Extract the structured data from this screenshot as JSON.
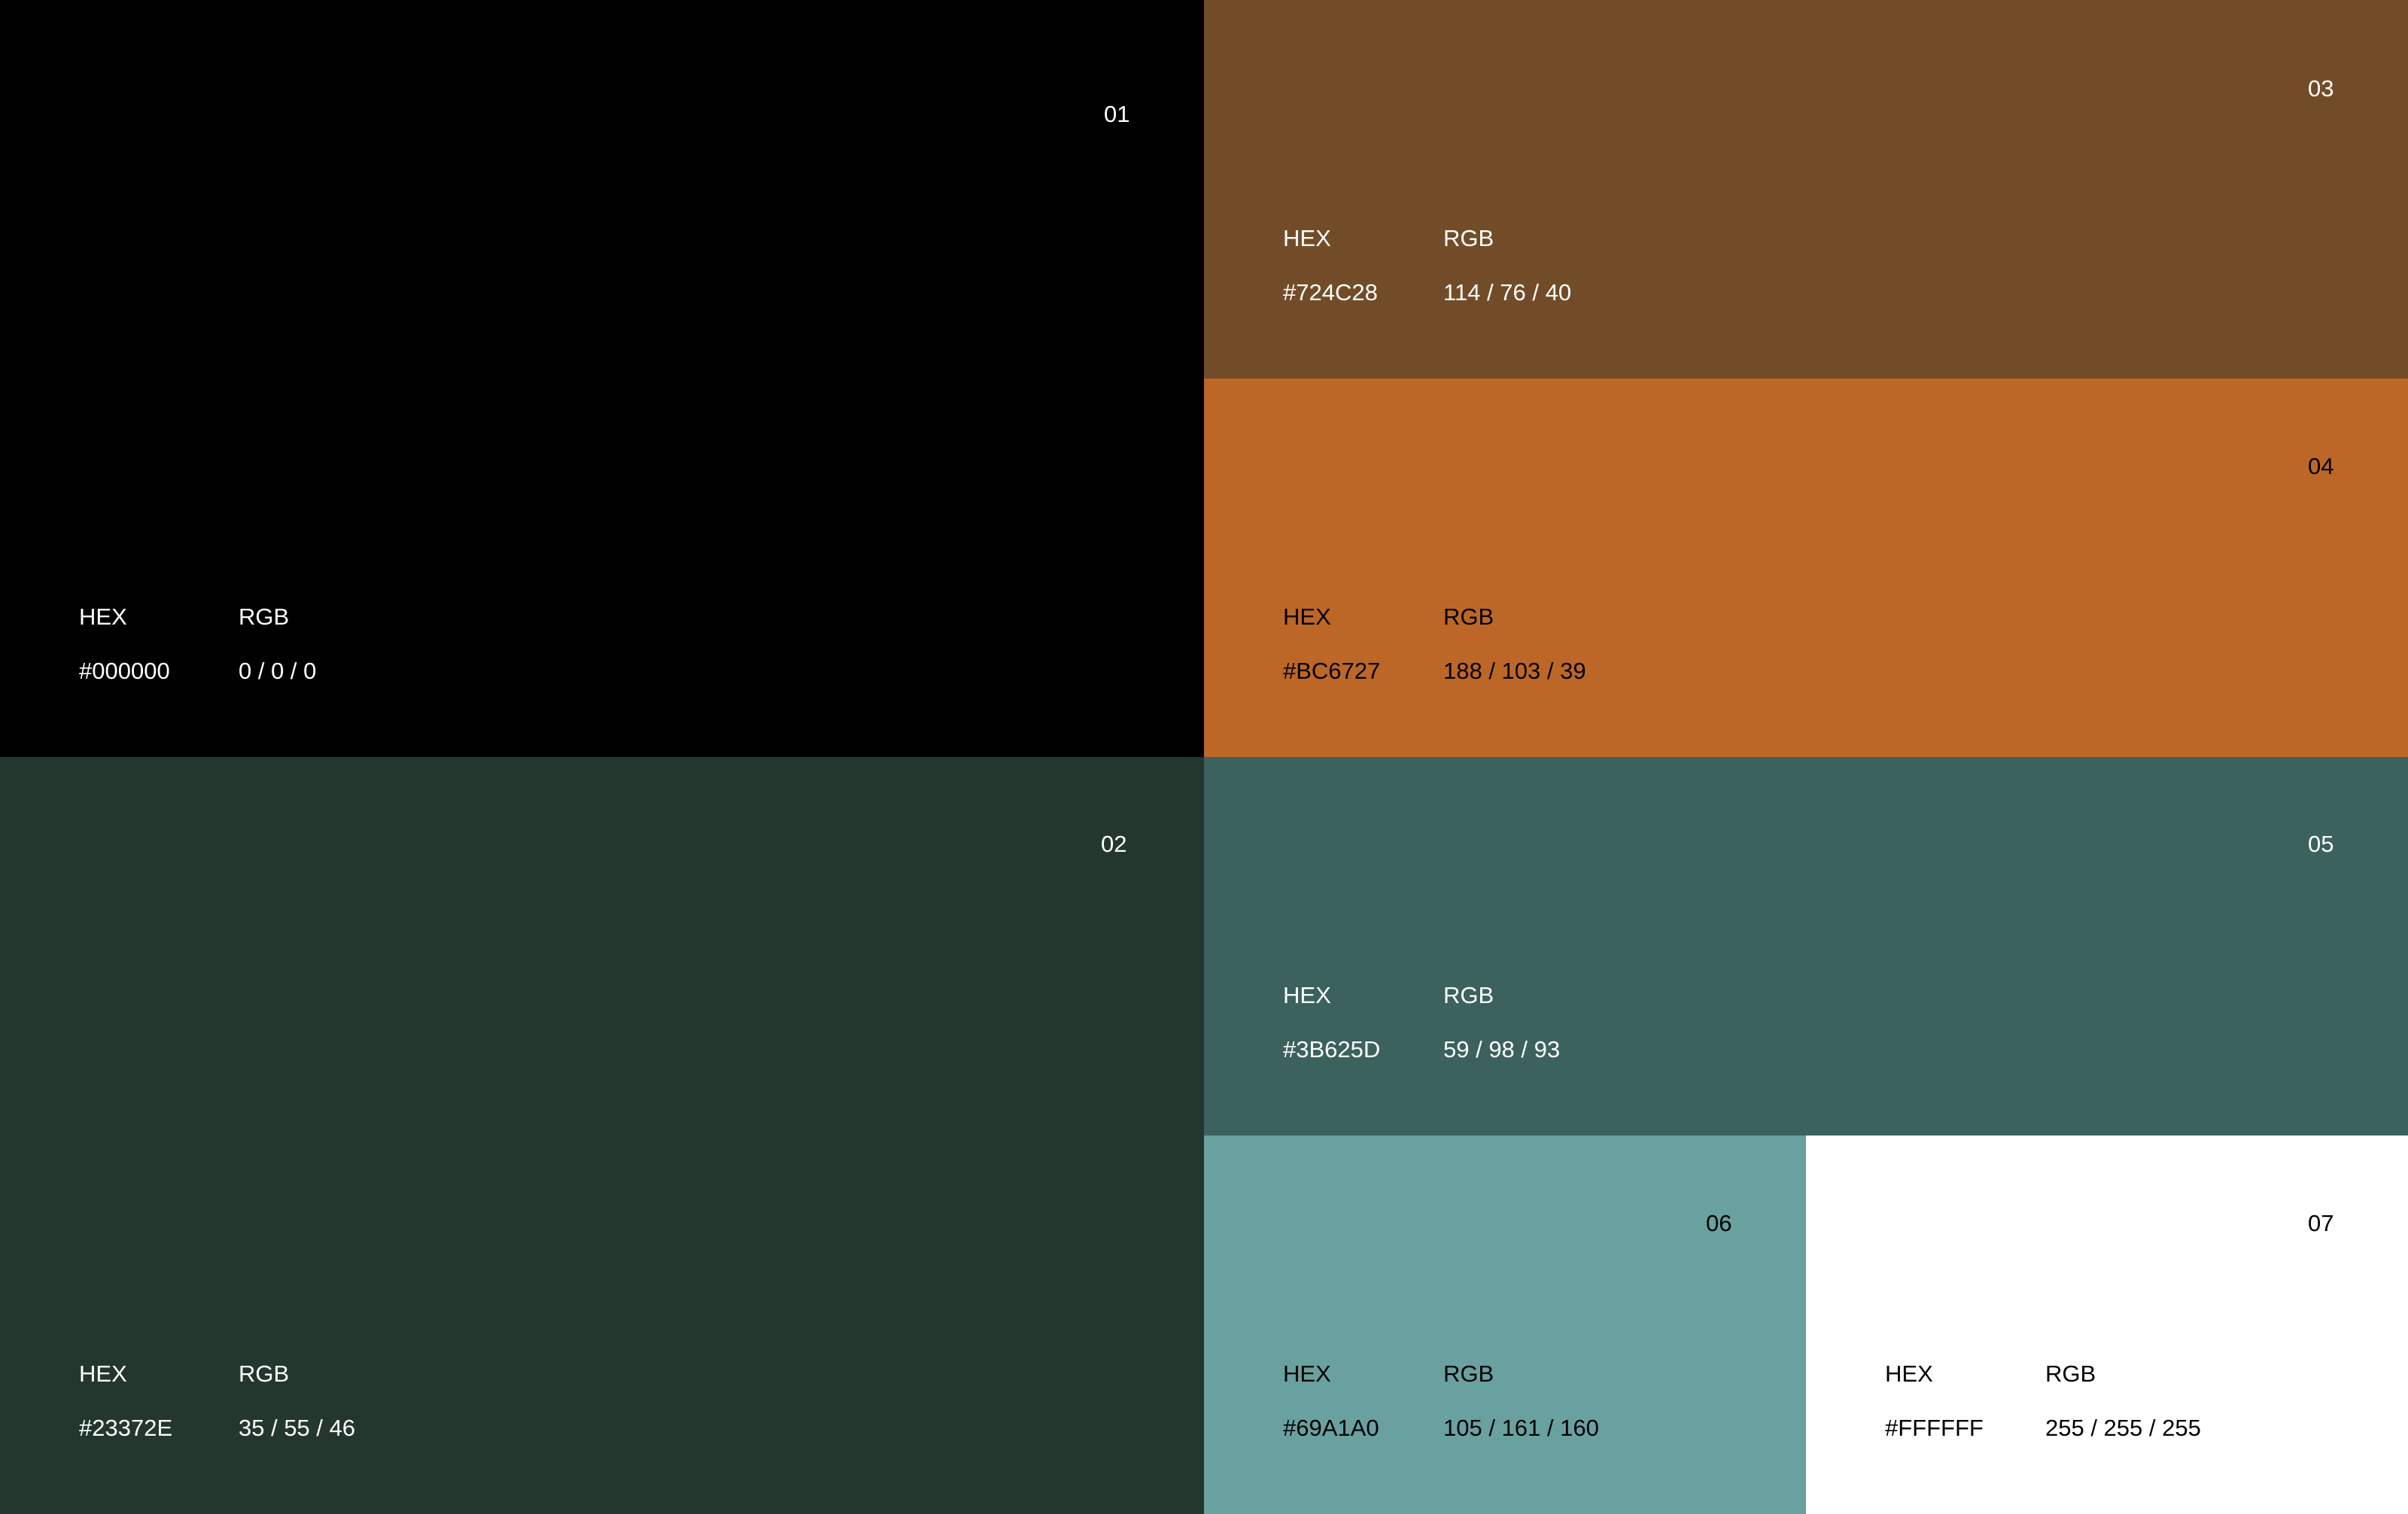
{
  "swatches": [
    {
      "number": "01",
      "hex_label": "HEX",
      "rgb_label": "RGB",
      "hex": "#000000",
      "rgb": "0 / 0 / 0",
      "color": "#000000"
    },
    {
      "number": "02",
      "hex_label": "HEX",
      "rgb_label": "RGB",
      "hex": "#23372E",
      "rgb": "35 / 55 / 46",
      "color": "#23372E"
    },
    {
      "number": "03",
      "hex_label": "HEX",
      "rgb_label": "RGB",
      "hex": "#724C28",
      "rgb": "114 / 76 / 40",
      "color": "#724C28"
    },
    {
      "number": "04",
      "hex_label": "HEX",
      "rgb_label": "RGB",
      "hex": "#BC6727",
      "rgb": "188 / 103 / 39",
      "color": "#BC6727"
    },
    {
      "number": "05",
      "hex_label": "HEX",
      "rgb_label": "RGB",
      "hex": "#3B625D",
      "rgb": "59 / 98 / 93",
      "color": "#3B625D"
    },
    {
      "number": "06",
      "hex_label": "HEX",
      "rgb_label": "RGB",
      "hex": "#69A1A0",
      "rgb": "105 / 161 / 160",
      "color": "#69A1A0"
    },
    {
      "number": "07",
      "hex_label": "HEX",
      "rgb_label": "RGB",
      "hex": "#FFFFFF",
      "rgb": "255 / 255 / 255",
      "color": "#FFFFFF"
    }
  ]
}
